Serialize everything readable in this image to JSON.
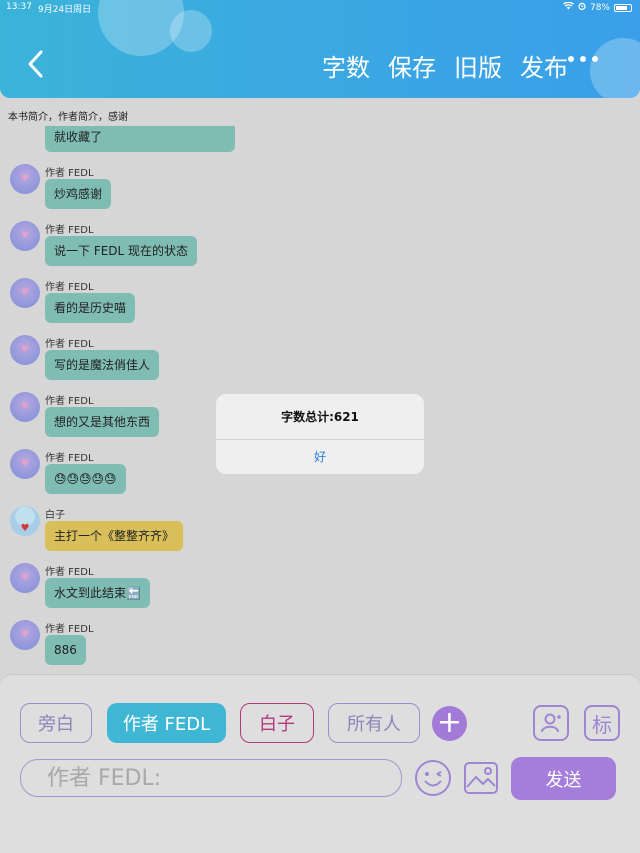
{
  "status": {
    "time": "13:37",
    "date": "9月24日周日",
    "battery": "78%"
  },
  "header": {
    "actions": [
      "字数",
      "保存",
      "旧版",
      "发布"
    ]
  },
  "breadcrumb": "本书简介，作者简介，感谢",
  "messages": [
    {
      "speaker": "",
      "text": "就收藏了",
      "style": "teal"
    },
    {
      "speaker": "作者 FEDL",
      "text": "炒鸡感谢",
      "style": "teal"
    },
    {
      "speaker": "作者 FEDL",
      "text": "说一下 FEDL 现在的状态",
      "style": "teal"
    },
    {
      "speaker": "作者 FEDL",
      "text": "看的是历史喵",
      "style": "teal"
    },
    {
      "speaker": "作者 FEDL",
      "text": "写的是魔法俏佳人",
      "style": "teal"
    },
    {
      "speaker": "作者 FEDL",
      "text": "想的又是其他东西",
      "style": "teal"
    },
    {
      "speaker": "作者 FEDL",
      "text": "😓😓😓😓😓",
      "style": "teal"
    },
    {
      "speaker": "白子",
      "text": "主打一个《整整齐齐》",
      "style": "yellow"
    },
    {
      "speaker": "作者 FEDL",
      "text": "水文到此结束🔚",
      "style": "teal"
    },
    {
      "speaker": "作者 FEDL",
      "text": "886",
      "style": "teal"
    }
  ],
  "dialog": {
    "message": "字数总计:621",
    "ok": "好"
  },
  "roles": {
    "narrator": "旁白",
    "author": "作者 FEDL",
    "baizi": "白子",
    "all": "所有人"
  },
  "tag_label": "标",
  "input": {
    "placeholder": "作者 FEDL:"
  },
  "send_label": "发送",
  "colors": {
    "header": "#3aa6e3",
    "teal_bubble": "#7fbcb3",
    "yellow_bubble": "#d9bf5a",
    "accent": "#a57edc",
    "active_role": "#3fb6d3"
  }
}
